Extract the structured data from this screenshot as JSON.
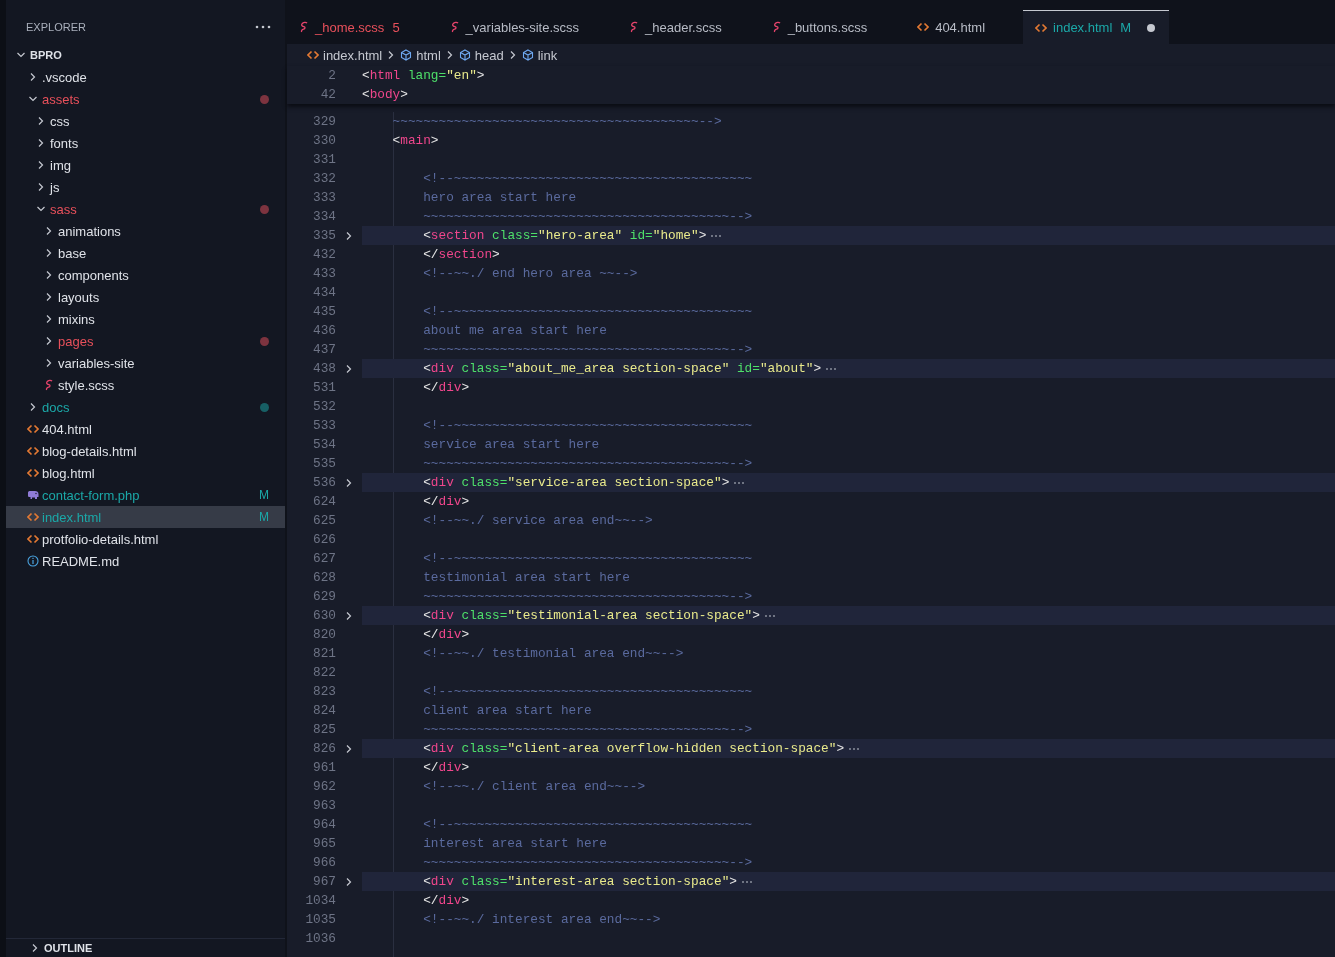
{
  "sidebar": {
    "title": "EXPLORER",
    "tree": {
      "name": "BPRO",
      "expanded": true,
      "children": [
        {
          "name": ".vscode",
          "kind": "folder",
          "expanded": false,
          "selected": false
        },
        {
          "name": "assets",
          "kind": "folder",
          "expanded": true,
          "selected": false,
          "color": "#e8505b",
          "dot": true,
          "children": [
            {
              "name": "css",
              "kind": "folder",
              "expanded": false,
              "selected": false
            },
            {
              "name": "fonts",
              "kind": "folder",
              "expanded": false,
              "selected": false
            },
            {
              "name": "img",
              "kind": "folder",
              "expanded": false,
              "selected": false
            },
            {
              "name": "js",
              "kind": "folder",
              "expanded": false,
              "selected": false
            },
            {
              "name": "sass",
              "kind": "folder",
              "expanded": true,
              "selected": false,
              "color": "#e8505b",
              "dot": true,
              "children": [
                {
                  "name": "animations",
                  "kind": "folder",
                  "expanded": false,
                  "selected": false
                },
                {
                  "name": "base",
                  "kind": "folder",
                  "expanded": false,
                  "selected": false
                },
                {
                  "name": "components",
                  "kind": "folder",
                  "expanded": false,
                  "selected": false
                },
                {
                  "name": "layouts",
                  "kind": "folder",
                  "expanded": false,
                  "selected": false
                },
                {
                  "name": "mixins",
                  "kind": "folder",
                  "expanded": false,
                  "selected": false
                },
                {
                  "name": "pages",
                  "kind": "folder",
                  "expanded": false,
                  "selected": false,
                  "color": "#e8505b",
                  "dot": true
                },
                {
                  "name": "variables-site",
                  "kind": "folder",
                  "expanded": false,
                  "selected": false
                },
                {
                  "name": "style.scss",
                  "kind": "scss",
                  "selected": false
                }
              ]
            }
          ]
        },
        {
          "name": "docs",
          "kind": "folder",
          "expanded": false,
          "selected": false,
          "color": "#1ba8a8",
          "dot": true
        },
        {
          "name": "404.html",
          "kind": "html",
          "selected": false
        },
        {
          "name": "blog-details.html",
          "kind": "html",
          "selected": false
        },
        {
          "name": "blog.html",
          "kind": "html",
          "selected": false
        },
        {
          "name": "contact-form.php",
          "kind": "php",
          "selected": false,
          "color": "#1ba8a8",
          "badge": "M"
        },
        {
          "name": "index.html",
          "kind": "html",
          "selected": true,
          "color": "#1ba8a8",
          "badge": "M"
        },
        {
          "name": "protfolio-details.html",
          "kind": "html",
          "selected": false
        },
        {
          "name": "README.md",
          "kind": "info",
          "selected": false
        }
      ]
    },
    "outline": {
      "title": "OUTLINE",
      "expanded": false
    }
  },
  "tabs": [
    {
      "name": "_home.scss",
      "kind": "scss",
      "selected": false,
      "color": "#e8505b",
      "badge": "5",
      "dirty": false
    },
    {
      "name": "_variables-site.scss",
      "kind": "scss",
      "selected": false,
      "dirty": false
    },
    {
      "name": "_header.scss",
      "kind": "scss",
      "selected": false,
      "dirty": false
    },
    {
      "name": "_buttons.scss",
      "kind": "scss",
      "selected": false,
      "dirty": false
    },
    {
      "name": "404.html",
      "kind": "html",
      "selected": false,
      "dirty": false
    },
    {
      "name": "index.html",
      "kind": "html",
      "selected": true,
      "color": "#1ba8a8",
      "badge": "M",
      "dirty": true
    }
  ],
  "breadcrumb": [
    {
      "label": "index.html",
      "kind": "html"
    },
    {
      "label": "html",
      "kind": "element"
    },
    {
      "label": "head",
      "kind": "element"
    },
    {
      "label": "link",
      "kind": "element"
    }
  ],
  "sticky_lines": [
    {
      "number": "2",
      "folded": false,
      "tokens": [
        {
          "kind": "punct",
          "text": "<"
        },
        {
          "kind": "tag",
          "text": "html"
        },
        {
          "kind": "attr",
          "text": " lang="
        },
        {
          "kind": "string",
          "text": "\"en\""
        },
        {
          "kind": "punct",
          "text": ">"
        }
      ]
    },
    {
      "number": "42",
      "folded": false,
      "tokens": [
        {
          "kind": "punct",
          "text": "<"
        },
        {
          "kind": "tag",
          "text": "body"
        },
        {
          "kind": "punct",
          "text": ">"
        }
      ]
    }
  ],
  "lines": [
    {
      "number": "329",
      "folded": false,
      "tokens": [
        {
          "kind": "comment",
          "text": "~~~~~~~~~~~~~~~~~~~~~~~~~~~~~~~~~~~~~~~~-->"
        }
      ]
    },
    {
      "number": "330",
      "folded": false,
      "tokens": [
        {
          "kind": "punct",
          "text": "<"
        },
        {
          "kind": "tag",
          "text": "main"
        },
        {
          "kind": "punct",
          "text": ">"
        }
      ],
      "children": [
        {
          "number": "331",
          "folded": false
        },
        {
          "number": "332",
          "folded": false,
          "tokens": [
            {
              "kind": "comment",
              "text": "<!--~~~~~~~~~~~~~~~~~~~~~~~~~~~~~~~~~~~~~~~"
            }
          ]
        },
        {
          "number": "333",
          "folded": false,
          "tokens": [
            {
              "kind": "comment",
              "text": "hero area start here"
            }
          ]
        },
        {
          "number": "334",
          "folded": false,
          "tokens": [
            {
              "kind": "comment",
              "text": "~~~~~~~~~~~~~~~~~~~~~~~~~~~~~~~~~~~~~~~~-->"
            }
          ]
        },
        {
          "number": "335",
          "folded": true,
          "tokens": [
            {
              "kind": "punct",
              "text": "<"
            },
            {
              "kind": "tag",
              "text": "section"
            },
            {
              "kind": "attr",
              "text": " class="
            },
            {
              "kind": "string",
              "text": "\"hero-area\""
            },
            {
              "kind": "attr",
              "text": " id="
            },
            {
              "kind": "string",
              "text": "\"home\""
            },
            {
              "kind": "punct",
              "text": ">"
            }
          ]
        },
        {
          "number": "432",
          "folded": false,
          "tokens": [
            {
              "kind": "punct",
              "text": "</"
            },
            {
              "kind": "tag",
              "text": "section"
            },
            {
              "kind": "punct",
              "text": ">"
            }
          ]
        },
        {
          "number": "433",
          "folded": false,
          "tokens": [
            {
              "kind": "comment",
              "text": "<!--~~./ end hero area ~~-->"
            }
          ]
        },
        {
          "number": "434",
          "folded": false
        },
        {
          "number": "435",
          "folded": false,
          "tokens": [
            {
              "kind": "comment",
              "text": "<!--~~~~~~~~~~~~~~~~~~~~~~~~~~~~~~~~~~~~~~~"
            }
          ]
        },
        {
          "number": "436",
          "folded": false,
          "tokens": [
            {
              "kind": "comment",
              "text": "about me area start here"
            }
          ]
        },
        {
          "number": "437",
          "folded": false,
          "tokens": [
            {
              "kind": "comment",
              "text": "~~~~~~~~~~~~~~~~~~~~~~~~~~~~~~~~~~~~~~~~-->"
            }
          ]
        },
        {
          "number": "438",
          "folded": true,
          "tokens": [
            {
              "kind": "punct",
              "text": "<"
            },
            {
              "kind": "tag",
              "text": "div"
            },
            {
              "kind": "attr",
              "text": " class="
            },
            {
              "kind": "string",
              "text": "\"about_me_area section-space\""
            },
            {
              "kind": "attr",
              "text": " id="
            },
            {
              "kind": "string",
              "text": "\"about\""
            },
            {
              "kind": "punct",
              "text": ">"
            }
          ]
        },
        {
          "number": "531",
          "folded": false,
          "tokens": [
            {
              "kind": "punct",
              "text": "</"
            },
            {
              "kind": "tag",
              "text": "div"
            },
            {
              "kind": "punct",
              "text": ">"
            }
          ]
        },
        {
          "number": "532",
          "folded": false
        },
        {
          "number": "533",
          "folded": false,
          "tokens": [
            {
              "kind": "comment",
              "text": "<!--~~~~~~~~~~~~~~~~~~~~~~~~~~~~~~~~~~~~~~~"
            }
          ]
        },
        {
          "number": "534",
          "folded": false,
          "tokens": [
            {
              "kind": "comment",
              "text": "service area start here"
            }
          ]
        },
        {
          "number": "535",
          "folded": false,
          "tokens": [
            {
              "kind": "comment",
              "text": "~~~~~~~~~~~~~~~~~~~~~~~~~~~~~~~~~~~~~~~~-->"
            }
          ]
        },
        {
          "number": "536",
          "folded": true,
          "tokens": [
            {
              "kind": "punct",
              "text": "<"
            },
            {
              "kind": "tag",
              "text": "div"
            },
            {
              "kind": "attr",
              "text": " class="
            },
            {
              "kind": "string",
              "text": "\"service-area section-space\""
            },
            {
              "kind": "punct",
              "text": ">"
            }
          ]
        },
        {
          "number": "624",
          "folded": false,
          "tokens": [
            {
              "kind": "punct",
              "text": "</"
            },
            {
              "kind": "tag",
              "text": "div"
            },
            {
              "kind": "punct",
              "text": ">"
            }
          ]
        },
        {
          "number": "625",
          "folded": false,
          "tokens": [
            {
              "kind": "comment",
              "text": "<!--~~./ service area end~~-->"
            }
          ]
        },
        {
          "number": "626",
          "folded": false
        },
        {
          "number": "627",
          "folded": false,
          "tokens": [
            {
              "kind": "comment",
              "text": "<!--~~~~~~~~~~~~~~~~~~~~~~~~~~~~~~~~~~~~~~~"
            }
          ]
        },
        {
          "number": "628",
          "folded": false,
          "tokens": [
            {
              "kind": "comment",
              "text": "testimonial area start here"
            }
          ]
        },
        {
          "number": "629",
          "folded": false,
          "tokens": [
            {
              "kind": "comment",
              "text": "~~~~~~~~~~~~~~~~~~~~~~~~~~~~~~~~~~~~~~~~-->"
            }
          ]
        },
        {
          "number": "630",
          "folded": true,
          "tokens": [
            {
              "kind": "punct",
              "text": "<"
            },
            {
              "kind": "tag",
              "text": "div"
            },
            {
              "kind": "attr",
              "text": " class="
            },
            {
              "kind": "string",
              "text": "\"testimonial-area section-space\""
            },
            {
              "kind": "punct",
              "text": ">"
            }
          ]
        },
        {
          "number": "820",
          "folded": false,
          "tokens": [
            {
              "kind": "punct",
              "text": "</"
            },
            {
              "kind": "tag",
              "text": "div"
            },
            {
              "kind": "punct",
              "text": ">"
            }
          ]
        },
        {
          "number": "821",
          "folded": false,
          "tokens": [
            {
              "kind": "comment",
              "text": "<!--~~./ testimonial area end~~-->"
            }
          ]
        },
        {
          "number": "822",
          "folded": false
        },
        {
          "number": "823",
          "folded": false,
          "tokens": [
            {
              "kind": "comment",
              "text": "<!--~~~~~~~~~~~~~~~~~~~~~~~~~~~~~~~~~~~~~~~"
            }
          ]
        },
        {
          "number": "824",
          "folded": false,
          "tokens": [
            {
              "kind": "comment",
              "text": "client area start here"
            }
          ]
        },
        {
          "number": "825",
          "folded": false,
          "tokens": [
            {
              "kind": "comment",
              "text": "~~~~~~~~~~~~~~~~~~~~~~~~~~~~~~~~~~~~~~~~-->"
            }
          ]
        },
        {
          "number": "826",
          "folded": true,
          "tokens": [
            {
              "kind": "punct",
              "text": "<"
            },
            {
              "kind": "tag",
              "text": "div"
            },
            {
              "kind": "attr",
              "text": " class="
            },
            {
              "kind": "string",
              "text": "\"client-area overflow-hidden section-space\""
            },
            {
              "kind": "punct",
              "text": ">"
            }
          ]
        },
        {
          "number": "961",
          "folded": false,
          "tokens": [
            {
              "kind": "punct",
              "text": "</"
            },
            {
              "kind": "tag",
              "text": "div"
            },
            {
              "kind": "punct",
              "text": ">"
            }
          ]
        },
        {
          "number": "962",
          "folded": false,
          "tokens": [
            {
              "kind": "comment",
              "text": "<!--~~./ client area end~~-->"
            }
          ]
        },
        {
          "number": "963",
          "folded": false
        },
        {
          "number": "964",
          "folded": false,
          "tokens": [
            {
              "kind": "comment",
              "text": "<!--~~~~~~~~~~~~~~~~~~~~~~~~~~~~~~~~~~~~~~~"
            }
          ]
        },
        {
          "number": "965",
          "folded": false,
          "tokens": [
            {
              "kind": "comment",
              "text": "interest area start here"
            }
          ]
        },
        {
          "number": "966",
          "folded": false,
          "tokens": [
            {
              "kind": "comment",
              "text": "~~~~~~~~~~~~~~~~~~~~~~~~~~~~~~~~~~~~~~~~-->"
            }
          ]
        },
        {
          "number": "967",
          "folded": true,
          "tokens": [
            {
              "kind": "punct",
              "text": "<"
            },
            {
              "kind": "tag",
              "text": "div"
            },
            {
              "kind": "attr",
              "text": " class="
            },
            {
              "kind": "string",
              "text": "\"interest-area section-space\""
            },
            {
              "kind": "punct",
              "text": ">"
            }
          ]
        },
        {
          "number": "1034",
          "folded": false,
          "tokens": [
            {
              "kind": "punct",
              "text": "</"
            },
            {
              "kind": "tag",
              "text": "div"
            },
            {
              "kind": "punct",
              "text": ">"
            }
          ]
        },
        {
          "number": "1035",
          "folded": false,
          "tokens": [
            {
              "kind": "comment",
              "text": "<!--~~./ interest area end~~-->"
            }
          ]
        },
        {
          "number": "1036",
          "folded": false
        }
      ]
    }
  ]
}
